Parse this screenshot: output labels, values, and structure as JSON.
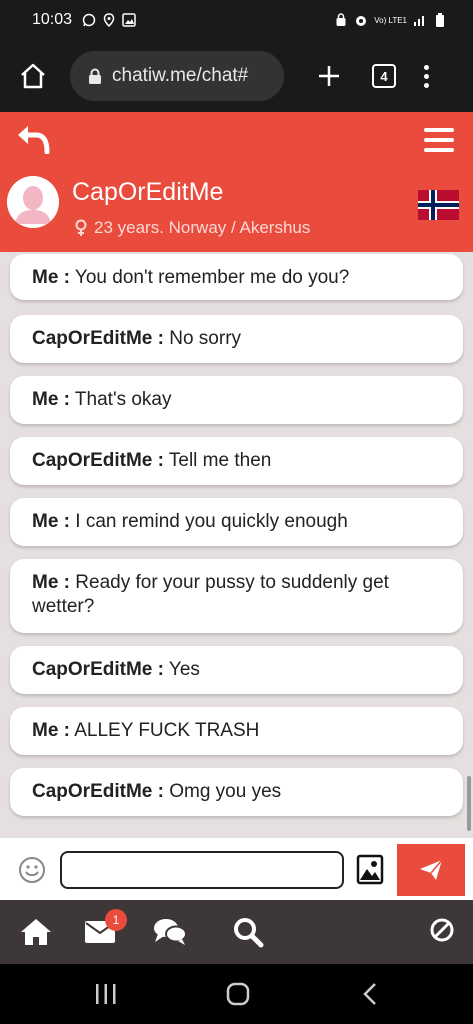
{
  "status_bar": {
    "time": "10:03",
    "network": "Vo) LTE1"
  },
  "browser": {
    "url": "chatiw.me/chat#",
    "tab_count": "4"
  },
  "header": {
    "username": "CapOrEditMe",
    "meta": "23 years. Norway / Akershus",
    "flag": "norway-flag"
  },
  "messages": [
    {
      "sender": "Me :",
      "text": " You don't remember me do you?"
    },
    {
      "sender": "CapOrEditMe :",
      "text": " No sorry"
    },
    {
      "sender": "Me :",
      "text": " That's okay"
    },
    {
      "sender": "CapOrEditMe :",
      "text": " Tell me then"
    },
    {
      "sender": "Me :",
      "text": " I can remind you quickly enough"
    },
    {
      "sender": "Me :",
      "text": " Ready for your pussy to suddenly get wetter?"
    },
    {
      "sender": "CapOrEditMe :",
      "text": " Yes"
    },
    {
      "sender": "Me :",
      "text": " ALLEY FUCK TRASH"
    },
    {
      "sender": "CapOrEditMe :",
      "text": " Omg you yes"
    }
  ],
  "input": {
    "value": "",
    "placeholder": ""
  },
  "nav": {
    "mail_badge": "1"
  },
  "colors": {
    "accent": "#e94b3c",
    "chat_bg": "#e5e0df",
    "nav_bg": "#3d3837"
  }
}
